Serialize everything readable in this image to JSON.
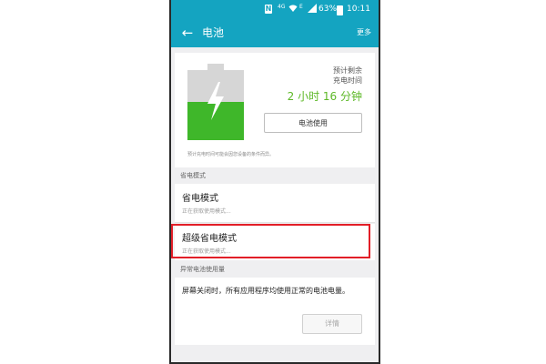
{
  "status_bar": {
    "notification_icon": "N",
    "network": "4G",
    "data_type": "E",
    "battery_percent": "63%",
    "time": "10:11"
  },
  "app_bar": {
    "back_icon": "←",
    "title": "电池",
    "more_label": "更多"
  },
  "battery": {
    "level_fraction": 0.55,
    "estimate_label_line1": "预计剩余",
    "estimate_label_line2": "充电时间",
    "estimate_value": "2 小时 16 分钟",
    "usage_button_label": "电池使用",
    "estimate_note": "预计充电时间可能会因您设备的条件而异。",
    "fill_color": "#3fb72a",
    "empty_color": "#d6d6d6"
  },
  "power_saving": {
    "section_title": "省电模式",
    "items": [
      {
        "title": "省电模式",
        "subtitle": "正在获取使用模式..."
      },
      {
        "title": "超级省电模式",
        "subtitle": "正在获取使用模式..."
      }
    ]
  },
  "abnormal": {
    "section_title": "异常电池使用量",
    "description": "屏幕关闭时，所有应用程序均使用正常的电池电量。",
    "details_button_label": "详情"
  },
  "colors": {
    "accent": "#14a4c1",
    "highlight": "#e21f28",
    "estimate_text": "#5db827"
  }
}
